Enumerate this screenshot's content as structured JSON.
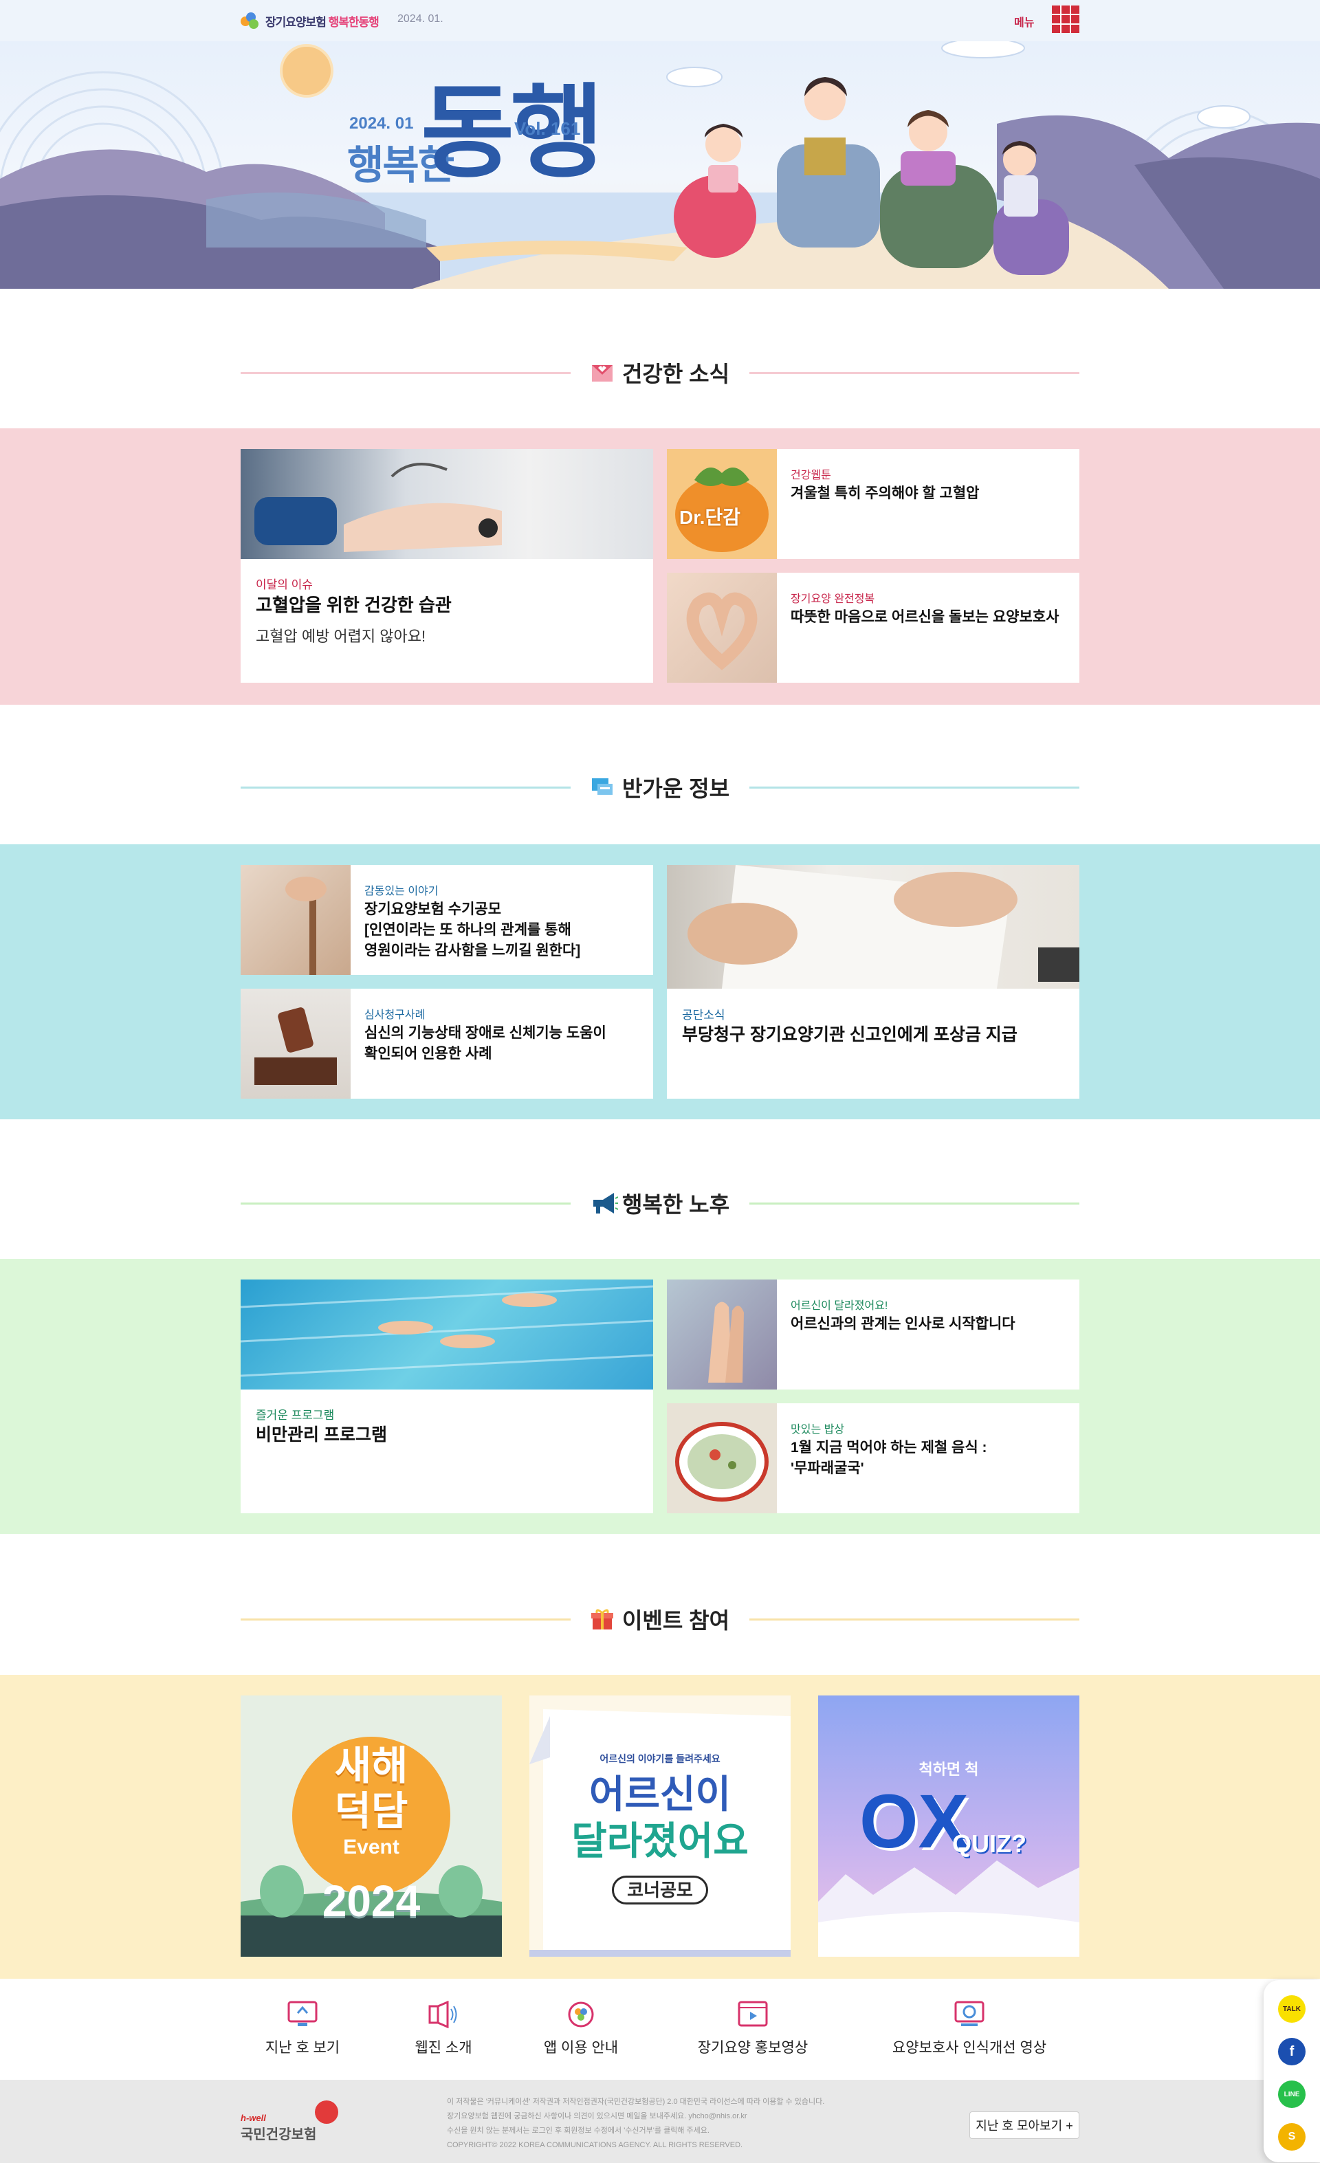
{
  "header": {
    "logo_text_a": "장기요양보험",
    "logo_text_b": "행복한동행",
    "issue_date": "2024. 01.",
    "menu_label": "메뉴"
  },
  "hero": {
    "date": "2024. 01",
    "title_small": "행복한",
    "title_big": "동행",
    "volume": "Vol. 161"
  },
  "sections": {
    "health": {
      "title": "건강한 소식",
      "color": "#f7d4d8"
    },
    "info": {
      "title": "반가운 정보",
      "color": "#b6e7ea"
    },
    "retire": {
      "title": "행복한 노후",
      "color": "#dcf7d8"
    },
    "event": {
      "title": "이벤트 참여",
      "color": "#fdefc6"
    }
  },
  "health_cards": {
    "main": {
      "category": "이달의 이슈",
      "title": "고혈압을 위한 건강한 습관",
      "subtitle": "고혈압 예방 어렵지 않아요!"
    },
    "webtoon": {
      "category": "건강웹툰",
      "title": "겨울철 특히 주의해야 할 고혈압",
      "img_label": "Dr.단감"
    },
    "policy": {
      "category": "장기요양 완전정복",
      "title": "따뜻한 마음으로 어르신을 돌보는 요양보호사"
    }
  },
  "info_cards": {
    "story": {
      "category": "감동있는 이야기",
      "title_lines": [
        "장기요양보험 수기공모",
        "[인연이라는 또 하나의 관계를 통해",
        "영원이라는 감사함을 느끼길 원한다]"
      ]
    },
    "review": {
      "category": "심사청구사례",
      "title_lines": [
        "심신의 기능상태 장애로 신체기능 도움이",
        "확인되어 인용한 사례"
      ]
    },
    "news": {
      "category": "공단소식",
      "title": "부당청구 장기요양기관 신고인에게 포상금 지급"
    }
  },
  "retire_cards": {
    "program": {
      "category": "즐거운 프로그램",
      "title": "비만관리 프로그램"
    },
    "changed": {
      "category": "어르신이 달라졌어요!",
      "title": "어르신과의 관계는 인사로 시작합니다"
    },
    "meal": {
      "category": "맛있는 밥상",
      "title_lines": [
        "1월 지금 먹어야 하는 제철 음식 :",
        "'무파래굴국'"
      ]
    }
  },
  "events": {
    "newyear": {
      "line1": "새해",
      "line2": "덕담",
      "line3": "Event",
      "year": "2024"
    },
    "contest": {
      "top": "어르신의 이야기를 들려주세요",
      "line1": "어르신이",
      "line2": "달라졌어요",
      "line3": "코너공모"
    },
    "quiz": {
      "top": "척하면 척",
      "ox": "OX",
      "quiz": "QUIZ?"
    }
  },
  "bottom_nav": [
    {
      "label": "지난 호 보기",
      "icon": "monitor-icon"
    },
    {
      "label": "웹진 소개",
      "icon": "speaker-icon"
    },
    {
      "label": "앱 이용 안내",
      "icon": "app-icon"
    },
    {
      "label": "장기요양 홍보영상",
      "icon": "video-icon"
    },
    {
      "label": "요양보호사 인식개선 영상",
      "icon": "play-screen-icon"
    }
  ],
  "footer": {
    "brand_small": "h-well",
    "brand": "국민건강보험",
    "legal_lines": [
      "이 저작물은 '커뮤니케이션' 저작권과 저작인접권자(국민건강보험공단) 2.0 대한민국 라이선스에 따라 이용할 수 있습니다.",
      "장기요양보험 웹진에 궁금하신 사항이나 의견이 있으시면 메일을 보내주세요. yhcho@nhis.or.kr",
      "수신을 원치 않는 분께서는 로그인 후 회원정보 수정에서 '수신거부'를 클릭해 주세요.",
      "COPYRIGHT© 2022 KOREA COMMUNICATIONS AGENCY. ALL RIGHTS RESERVED."
    ],
    "back_issues": "지난 호 모아보기 +"
  },
  "share": [
    {
      "label": "TALK",
      "color": "#f9e000",
      "icon": "kakaotalk-icon"
    },
    {
      "label": "f",
      "color": "#1b4fb0",
      "icon": "facebook-icon"
    },
    {
      "label": "LINE",
      "color": "#27c04b",
      "icon": "line-icon"
    },
    {
      "label": "S",
      "color": "#f3b300",
      "icon": "kakaostory-icon"
    }
  ]
}
